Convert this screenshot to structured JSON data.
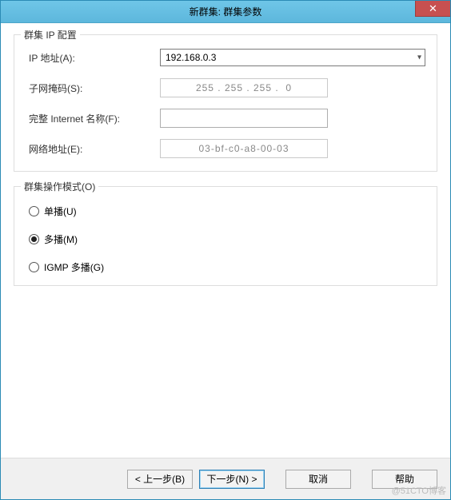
{
  "title": "新群集: 群集参数",
  "close": "✕",
  "group_ip": {
    "legend": "群集 IP 配置",
    "ip_label": "IP 地址(A):",
    "ip_value": "192.168.0.3",
    "subnet_label": "子网掩码(S):",
    "subnet_value": "255 . 255 . 255 .  0",
    "fqdn_label": "完整 Internet 名称(F):",
    "fqdn_value": "",
    "mac_label": "网络地址(E):",
    "mac_value": "03-bf-c0-a8-00-03"
  },
  "group_ops": {
    "legend": "群集操作模式(O)",
    "unicast": "单播(U)",
    "multicast": "多播(M)",
    "igmp": "IGMP 多播(G)",
    "selected": "multicast"
  },
  "buttons": {
    "back": "< 上一步(B)",
    "next": "下一步(N) >",
    "cancel": "取消",
    "help": "帮助"
  },
  "watermark": "@51CTO博客"
}
